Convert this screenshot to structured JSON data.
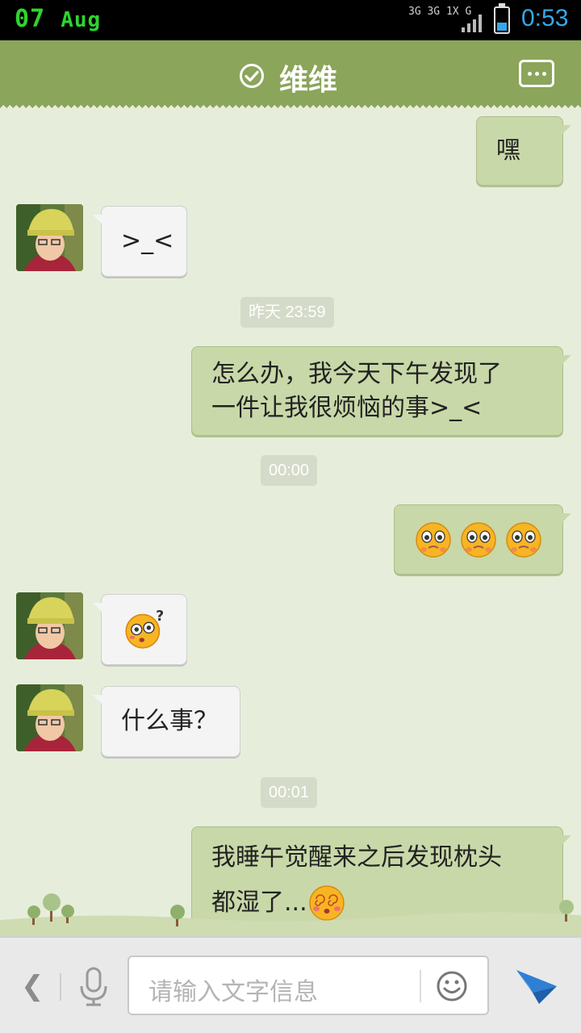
{
  "status_bar": {
    "date_day": "07",
    "date_month": "Aug",
    "network_line1": "3G 3G 1X G",
    "time": "0:53",
    "icons": [
      "network-icon",
      "signal-icon",
      "battery-icon"
    ]
  },
  "header": {
    "title": "维维",
    "icons": [
      "online-check-icon",
      "more-options-icon"
    ]
  },
  "messages": [
    {
      "side": "out",
      "text": "嘿"
    },
    {
      "side": "in",
      "text": ">_<"
    },
    {
      "type": "timestamp",
      "text": "昨天 23:59"
    },
    {
      "side": "out",
      "line1": "怎么办，我今天下午发现了",
      "line2": "一件让我很烦恼的事>_<"
    },
    {
      "type": "timestamp",
      "text": "00:00"
    },
    {
      "side": "out",
      "emoji": [
        "pitiful-emoji",
        "pitiful-emoji",
        "pitiful-emoji"
      ]
    },
    {
      "side": "in",
      "emoji": [
        "confused-emoji"
      ]
    },
    {
      "side": "in",
      "text": "什么事？"
    },
    {
      "type": "timestamp",
      "text": "00:01"
    },
    {
      "side": "out",
      "line1": "我睡午觉醒来之后发现枕头",
      "line2": "都湿了...",
      "emoji": [
        "dizzy-emoji"
      ]
    }
  ],
  "input_bar": {
    "placeholder": "请输入文字信息",
    "icons": [
      "back-icon",
      "microphone-icon",
      "smiley-icon",
      "send-icon"
    ]
  },
  "colors": {
    "header_bg": "#8ba55a",
    "chat_bg": "#e6eedb",
    "outgoing_bubble": "#c8d8a8",
    "incoming_bubble": "#f4f4f4",
    "clock_blue": "#35a8ea",
    "date_green": "#2fd42f"
  }
}
